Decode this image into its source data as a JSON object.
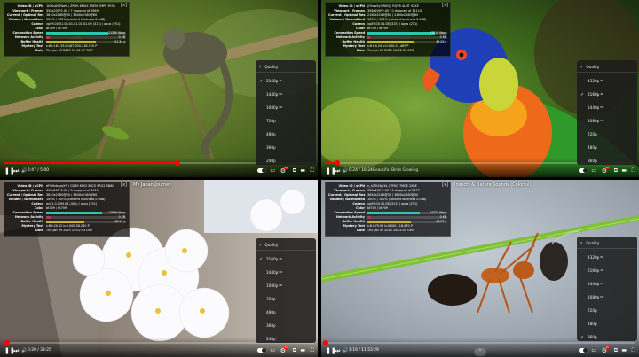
{
  "panes": [
    {
      "title": "",
      "stats": {
        "video_id": "Video ID / sCPN",
        "video_id_v": "1t0XsXVTNwY / ZRHK 6MUX SSEM 7MPF YE9X",
        "viewport": "Viewport / Frames",
        "viewport_v": "358x200*2.00 / 7 dropped of 5869",
        "current": "Current / Optimal Res",
        "current_v": "3840x2160@60 / 3840x2160@60",
        "volume": "Volume / Normalized",
        "volume_v": "100% / 100% (content loudness 0.0dB)",
        "codecs": "Codecs",
        "codecs_v": "vp09.00.51.08.01.01.01.01.00 (313) / opus (251)",
        "color": "Color",
        "color_v": "bt709 / bt709",
        "connection": "Connection Speed",
        "connection_v": "21340 Kbps",
        "network": "Network Activity",
        "network_v": "0 KB",
        "buffer": "Buffer Health",
        "buffer_v": "51.34 s",
        "mystery": "Mystery Text",
        "mystery_v": "s:8 t:167.35 b:167.000-218.720 P",
        "date": "Date",
        "date_v": "Thu Jan 09 2025 14:02:47 GMT"
      },
      "menu": {
        "header": "Quality",
        "items": [
          "2160p",
          "1440p",
          "1080p",
          "720p",
          "480p",
          "360p",
          "240p"
        ],
        "hd": [
          "4K",
          "HD",
          "HD",
          "",
          "",
          "",
          ""
        ],
        "selected": 0
      },
      "player": {
        "time": "2:47 / 5:00",
        "chapter": "",
        "progress": 0.56
      }
    },
    {
      "title": "",
      "stats": {
        "video_id": "Video ID / sCPN",
        "video_id_v": "jC9wb5y3WKQ / RQV8 4LMT 9ZXE",
        "viewport": "Viewport / Frames",
        "viewport_v": "358x200*2.00 / 0 dropped of 14110",
        "current": "Current / Optimal Res",
        "current_v": "2160x2160@60 / 2160x2160@60",
        "volume": "Volume / Normalized",
        "volume_v": "100% / 100% (content loudness 0.0dB)",
        "codecs": "Codecs",
        "codecs_v": "vp09.00.51.08 (315) / opus (251)",
        "color": "Color",
        "color_v": "bt709 / bt709",
        "connection": "Connection Speed",
        "connection_v": "27518 Kbps",
        "network": "Network Activity",
        "network_v": "0 KB",
        "buffer": "Buffer Health",
        "buffer_v": "47.23 s",
        "mystery": "Mystery Text",
        "mystery_v": "s:8 t:4.24 b:0.000-51.467 P",
        "date": "Date",
        "date_v": "Thu Jan 09 2025 14:02:50 GMT"
      },
      "menu": {
        "header": "Quality",
        "items": [
          "4320p",
          "2160p",
          "1440p",
          "1080p",
          "720p",
          "480p",
          "360p"
        ],
        "hd": [
          "8K",
          "4K",
          "HD",
          "HD",
          "",
          "",
          ""
        ],
        "selected": 1
      },
      "player": {
        "time": "0:24 / 10:24",
        "chapter": "Beautiful Birds Glowing",
        "progress": 0.04
      }
    },
    {
      "title": "My Japan Journey",
      "stats": {
        "video_id": "Video ID / sCPN",
        "video_id_v": "dFQ9vb4pqY9 / CDB9 KFV2 8KCS 9RG2 3N8G",
        "viewport": "Viewport / Frames",
        "viewport_v": "358x200*2.00 / 3 dropped of 4911",
        "current": "Current / Optimal Res",
        "current_v": "3840x2160@60 / 3840x2160@60",
        "volume": "Volume / Normalized",
        "volume_v": "100% / 100% (content loudness 0.0dB)",
        "codecs": "Codecs",
        "codecs_v": "av01.0.12M.08 (401) / opus (251)",
        "color": "Color",
        "color_v": "bt709 / bt709",
        "connection": "Connection Speed",
        "connection_v": "17856 Kbps",
        "network": "Network Activity",
        "network_v": "0 KB",
        "buffer": "Buffer Health",
        "buffer_v": "38.11 s",
        "mystery": "Mystery Text",
        "mystery_v": "s:8 t:20.12 b:0.000-58.230 P",
        "date": "Date",
        "date_v": "Thu Jan 09 2025 14:02:53 GMT"
      },
      "menu": {
        "header": "Quality",
        "items": [
          "2160p",
          "1440p",
          "1080p",
          "720p",
          "480p",
          "360p",
          "240p"
        ],
        "hd": [
          "4K",
          "HD",
          "HD",
          "",
          "",
          "",
          ""
        ],
        "selected": 0
      },
      "player": {
        "time": "0:20 / 39:25",
        "chapter": "",
        "progress": 0.01
      }
    },
    {
      "title": "Insects & Nature Sounds (Colorful)",
      "stats": {
        "video_id": "Video ID / sCPN",
        "video_id_v": "n_hZ9U3pfXc / 7FKG 7MQE 2XRE",
        "viewport": "Viewport / Frames",
        "viewport_v": "358x200*2.00 / 0 dropped of 2277",
        "current": "Current / Optimal Res",
        "current_v": "3840x2160@30 / 3840x2160@30",
        "volume": "Volume / Normalized",
        "volume_v": "100% / 100% (content loudness 0.0dB)",
        "codecs": "Codecs",
        "codecs_v": "vp09.00.51.08 (313) / opus (251)",
        "color": "Color",
        "color_v": "bt709 / bt709",
        "connection": "Connection Speed",
        "connection_v": "14722 Kbps",
        "network": "Network Activity",
        "network_v": "0 KB",
        "buffer": "Buffer Health",
        "buffer_v": "42.57 s",
        "mystery": "Mystery Text",
        "mystery_v": "s:8 t:75.90 b:0.000-118.470 P",
        "date": "Date",
        "date_v": "Thu Jan 09 2025 14:02:55 GMT"
      },
      "menu": {
        "header": "Quality",
        "items": [
          "4320p",
          "2160p",
          "1440p",
          "1080p",
          "720p",
          "480p",
          "360p"
        ],
        "hd": [
          "8K",
          "4K",
          "HD",
          "HD",
          "",
          "",
          ""
        ],
        "selected": 6
      },
      "player": {
        "time": "1:16 / 11:53:29",
        "chapter": "",
        "progress": 0.002
      }
    }
  ],
  "colors": {
    "progress": "#ff0000",
    "bar_connection": "#27c8ad",
    "bar_network": "#b3364e",
    "bar_buffer": "#c8b126"
  },
  "icons": [
    "pause-icon",
    "next-icon",
    "volume-icon",
    "autoplay-toggle",
    "subtitles-icon",
    "settings-icon",
    "miniplayer-icon",
    "theater-icon",
    "fullscreen-icon"
  ]
}
